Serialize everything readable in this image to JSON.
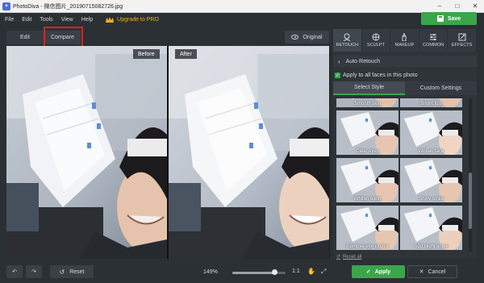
{
  "window": {
    "title": "PhotoDiva - 微信图片_20190715082726.jpg",
    "controls": [
      "–",
      "□",
      "✕"
    ]
  },
  "menu": {
    "items": [
      "File",
      "Edit",
      "Tools",
      "View",
      "Help"
    ],
    "upgrade": "Upgrade to PRO"
  },
  "toolbar": {
    "save": "Save"
  },
  "view": {
    "tabs": [
      "Edit",
      "Compare"
    ],
    "active_tab": "Compare",
    "original": "Original"
  },
  "canvas": {
    "before_label": "Before",
    "after_label": "After"
  },
  "categories": [
    {
      "label": "RETOUCH",
      "icon": "face-icon",
      "active": true
    },
    {
      "label": "SCULPT",
      "icon": "sculpt-icon",
      "active": false
    },
    {
      "label": "MAKEUP",
      "icon": "makeup-icon",
      "active": false
    },
    {
      "label": "COMMON",
      "icon": "sliders-icon",
      "active": false
    },
    {
      "label": "EFFECTS",
      "icon": "effects-icon",
      "active": false
    }
  ],
  "panel": {
    "section": "Auto Retouch",
    "apply_all": "Apply to all faces in this photo",
    "apply_all_checked": true,
    "subtabs": [
      "Select Style",
      "Custom Settings"
    ],
    "active_subtab": "Select Style",
    "partial_row": [
      "Smooth skin",
      "Bright lips"
    ],
    "styles": [
      "Clear eyes",
      "Whiten face",
      "Whiten teeth",
      "Shiny smile",
      "Remove eye circles",
      "Add slight shine"
    ],
    "reset_all": "Reset all"
  },
  "bottom": {
    "reset": "Reset",
    "zoom": "149%",
    "zoom_level": 0.8,
    "one_to_one": "1:1",
    "apply": "Apply",
    "cancel": "Cancel"
  }
}
